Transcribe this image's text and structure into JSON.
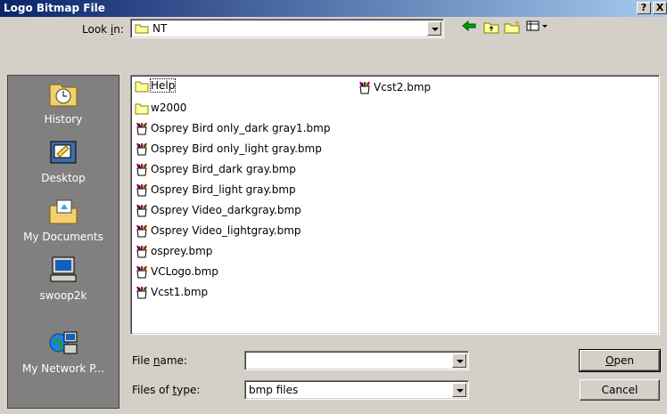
{
  "title": "Logo Bitmap File",
  "title_buttons": {
    "help": "?",
    "close": "X"
  },
  "look_in": {
    "label": "Look in:",
    "value": "NT"
  },
  "toolbar": {
    "back_icon": "back-arrow-icon",
    "up_icon": "up-folder-icon",
    "new_folder_icon": "new-folder-icon",
    "view_icon": "view-menu-icon"
  },
  "places": [
    {
      "label": "History",
      "icon": "history-icon"
    },
    {
      "label": "Desktop",
      "icon": "desktop-icon"
    },
    {
      "label": "My Documents",
      "icon": "my-documents-icon"
    },
    {
      "label": "swoop2k",
      "icon": "computer-icon"
    },
    {
      "label": "My Network P...",
      "icon": "network-places-icon"
    }
  ],
  "files_col1": [
    {
      "name": "Help",
      "type": "folder"
    },
    {
      "name": "w2000",
      "type": "folder"
    },
    {
      "name": "Osprey Bird only_dark gray1.bmp",
      "type": "bmp"
    },
    {
      "name": "Osprey Bird only_light gray.bmp",
      "type": "bmp"
    },
    {
      "name": "Osprey Bird_dark gray.bmp",
      "type": "bmp"
    },
    {
      "name": "Osprey Bird_light gray.bmp",
      "type": "bmp"
    },
    {
      "name": "Osprey Video_darkgray.bmp",
      "type": "bmp"
    },
    {
      "name": "Osprey Video_lightgray.bmp",
      "type": "bmp"
    },
    {
      "name": "osprey.bmp",
      "type": "bmp"
    },
    {
      "name": "VCLogo.bmp",
      "type": "bmp"
    },
    {
      "name": "Vcst1.bmp",
      "type": "bmp"
    }
  ],
  "files_col2": [
    {
      "name": "Vcst2.bmp",
      "type": "bmp"
    }
  ],
  "file_name": {
    "label": "File name:",
    "value": ""
  },
  "file_type": {
    "label": "Files of type:",
    "value": "bmp files"
  },
  "buttons": {
    "open": "Open",
    "cancel": "Cancel"
  }
}
